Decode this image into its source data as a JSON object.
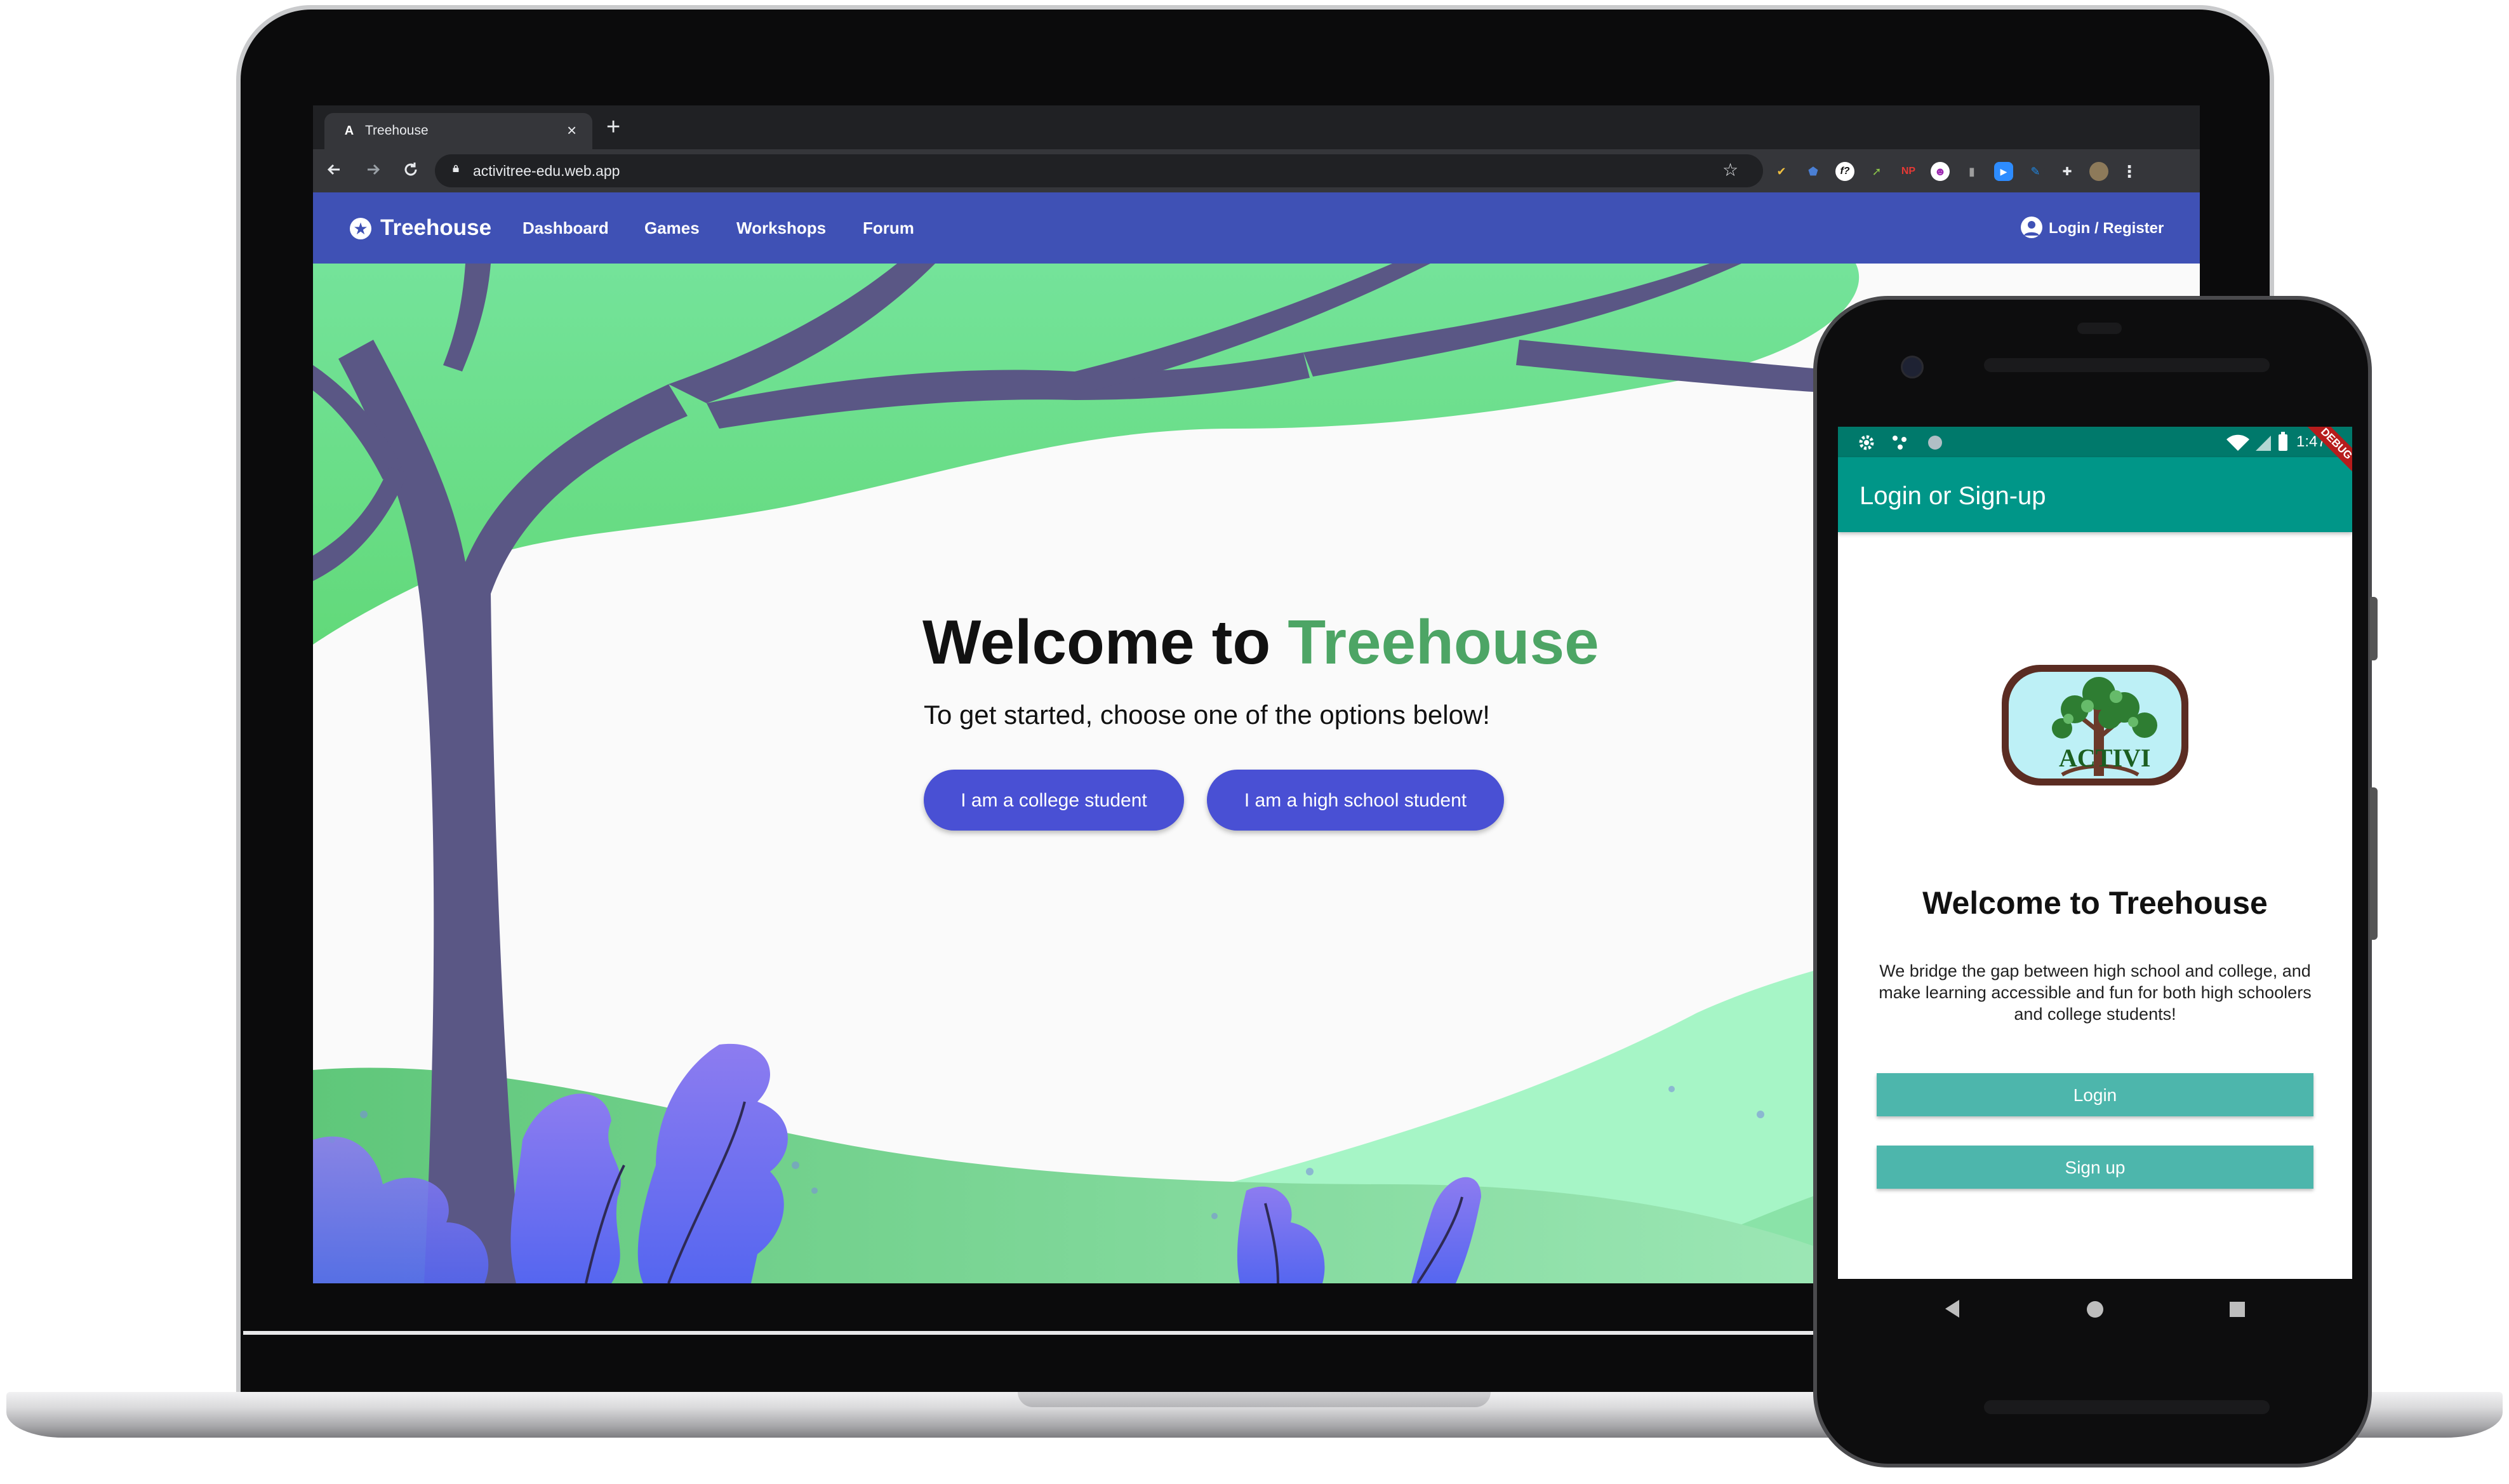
{
  "browser": {
    "tab_title": "Treehouse",
    "tab_favicon": "A",
    "tab_close": "×",
    "new_tab": "+",
    "url": "activitree-edu.web.app",
    "ext_labels": [
      "f?",
      "NP"
    ]
  },
  "site": {
    "brand": "Treehouse",
    "nav": [
      "Dashboard",
      "Games",
      "Workshops",
      "Forum"
    ],
    "login_register": "Login / Register",
    "hero": {
      "title_prefix": "Welcome to ",
      "title_accent": "Treehouse",
      "subtitle": "To get started, choose one of the options below!",
      "btn_college": "I am a college student",
      "btn_highschool": "I am a high school student"
    }
  },
  "phone": {
    "status_time": "1:47",
    "debug_label": "DEBUG",
    "appbar_title": "Login or Sign-up",
    "logo_text": "ACTIVI",
    "welcome": "Welcome to Treehouse",
    "description": "We bridge the gap between high school and college, and make learning accessible and fun for both high schoolers and college students!",
    "login_label": "Login",
    "signup_label": "Sign up"
  },
  "colors": {
    "nav_bar": "#3f51b5",
    "hero_button": "#4950d4",
    "accent_green": "#4da565",
    "app_bar": "#009688",
    "app_button": "#4db6ac",
    "tree_trunk": "#5a5785",
    "foliage": "#6de08a"
  },
  "icons": [
    "star-icon",
    "user-icon",
    "back-icon",
    "forward-icon",
    "reload-icon",
    "lock-icon",
    "bookmark-star-icon",
    "extensions-icon",
    "menu-icon",
    "settings-icon",
    "wifi-icon",
    "battery-icon",
    "back-triangle-icon",
    "home-circle-icon",
    "recents-square-icon"
  ]
}
